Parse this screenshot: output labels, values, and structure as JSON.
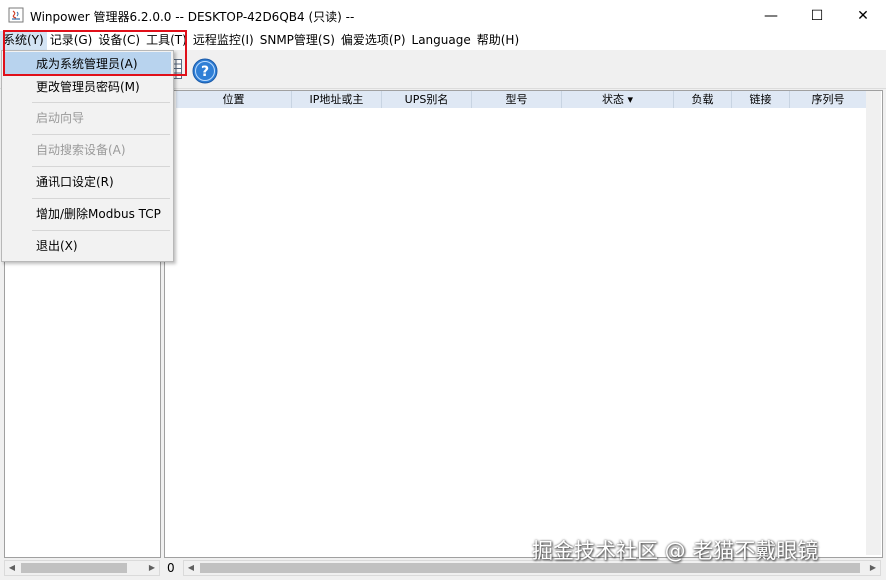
{
  "window": {
    "title": "Winpower 管理器6.2.0.0 -- DESKTOP-42D6QB4 (只读) --",
    "minimize": "—",
    "maximize": "☐",
    "close": "✕"
  },
  "menubar": {
    "items": [
      {
        "label": "系统(Y)",
        "active": true
      },
      {
        "label": "记录(G)"
      },
      {
        "label": "设备(C)"
      },
      {
        "label": "工具(T)"
      },
      {
        "label": "远程监控(I)"
      },
      {
        "label": "SNMP管理(S)"
      },
      {
        "label": "偏爱选项(P)"
      },
      {
        "label": "Language"
      },
      {
        "label": "帮助(H)"
      }
    ]
  },
  "system_menu": {
    "items": [
      {
        "label": "成为系统管理员(A)",
        "state": "highlighted"
      },
      {
        "label": "更改管理员密码(M)",
        "state": "enabled"
      },
      {
        "label": "启动向导",
        "state": "disabled"
      },
      {
        "label": "自动搜索设备(A)",
        "state": "disabled"
      },
      {
        "label": "通讯口设定(R)",
        "state": "enabled"
      },
      {
        "label": "增加/删除Modbus TCP",
        "state": "enabled"
      },
      {
        "label": "退出(X)",
        "state": "enabled"
      }
    ]
  },
  "table": {
    "columns": [
      "位置",
      "IP地址或主",
      "UPS别名",
      "型号",
      "状态 ▾",
      "负载",
      "链接",
      "序列号"
    ]
  },
  "status": {
    "count": "0"
  },
  "watermark": "掘金技术社区 @ 老猫不戴眼镜",
  "colors": {
    "highlight": "#b8d3ee",
    "annotation_box": "#e0101a",
    "header_bg": "#dfe8f4"
  }
}
